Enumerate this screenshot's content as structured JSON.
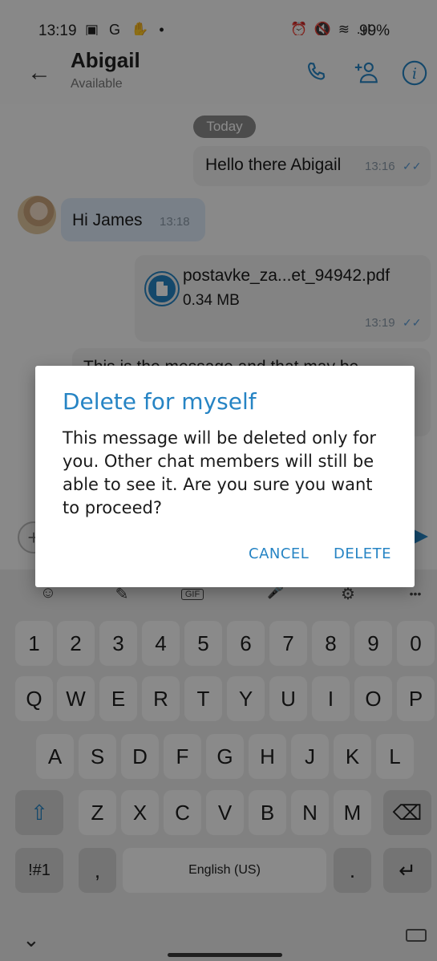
{
  "status_bar": {
    "time": "13:19",
    "left_icons": "▣ G ✋ •",
    "right_icons": "⏰ 🔇 ≋ .ıl",
    "battery": "99%"
  },
  "header": {
    "contact_name": "Abigail",
    "presence": "Available",
    "icons": [
      "back-arrow-icon",
      "phone-icon",
      "add-person-icon",
      "info-icon"
    ]
  },
  "chat": {
    "date_separator": "Today",
    "messages": [
      {
        "direction": "out",
        "text": "Hello there Abigail",
        "time": "13:16",
        "ticks": "✓✓"
      },
      {
        "direction": "in",
        "text": "Hi James",
        "time": "13:18"
      },
      {
        "direction": "out",
        "type": "file",
        "file_name": "postavke_za...et_94942.pdf",
        "file_size": "0.34 MB",
        "time": "13:19",
        "ticks": "✓✓"
      },
      {
        "direction": "out",
        "text": "This is the message and that may be",
        "time": "",
        "partially_hidden": true
      }
    ]
  },
  "dialog": {
    "title": "Delete for myself",
    "body": "This message will be deleted only for you. Other chat members will still be able to see it. Are you sure you want to proceed?",
    "cancel_label": "CANCEL",
    "delete_label": "DELETE"
  },
  "keyboard": {
    "toolbar": [
      "☺",
      "✎",
      "GIF",
      "🎤",
      "⚙",
      "•••"
    ],
    "rows": [
      [
        "1",
        "2",
        "3",
        "4",
        "5",
        "6",
        "7",
        "8",
        "9",
        "0"
      ],
      [
        "Q",
        "W",
        "E",
        "R",
        "T",
        "Y",
        "U",
        "I",
        "O",
        "P"
      ],
      [
        "A",
        "S",
        "D",
        "F",
        "G",
        "H",
        "J",
        "K",
        "L"
      ],
      [
        "⇧",
        "Z",
        "X",
        "C",
        "V",
        "B",
        "N",
        "M",
        "⌫"
      ],
      [
        "!#1",
        ",",
        "English (US)",
        ".",
        "↵"
      ]
    ]
  },
  "colors": {
    "accent": "#2684c4",
    "incoming_bubble": "#dde9f7",
    "outgoing_bubble": "#eeeeee"
  }
}
